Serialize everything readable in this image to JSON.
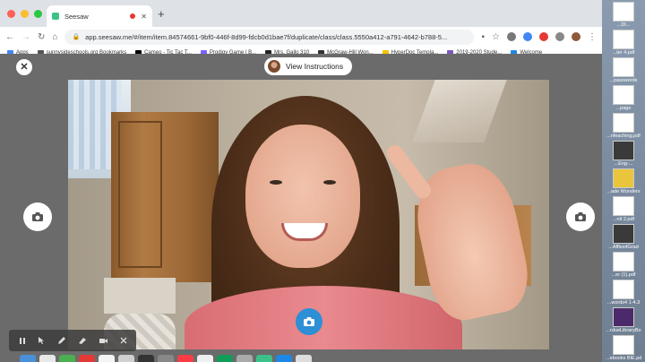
{
  "browser": {
    "tab_title": "Seesaw",
    "new_tab_symbol": "+",
    "url": "app.seesaw.me/#/item/item.84574661-9bf0-446f-8d99-fdcb0d1bae7f/duplicate/class/class.5550a412-a791-4642-b788-5...",
    "bookmarks": [
      "Apps",
      "sunnysideschools.org Bookmarks",
      "Cameo - Tic Tac T...",
      "Prodigy Game | B...",
      "Mrs. Gallo 310",
      "McGraw-Hill Won...",
      "HyperDoc Templa...",
      "2019-2020 Stude...",
      "Welcome"
    ],
    "bookmark_colors": [
      "#4285f4",
      "#555555",
      "#000000",
      "#7b61ff",
      "#222222",
      "#333333",
      "#f5c400",
      "#7e57c2",
      "#1e88e5"
    ]
  },
  "seesaw": {
    "close_symbol": "✕",
    "instructions_label": "View Instructions",
    "accent_color": "#2d8fd5"
  },
  "desktop_files": [
    {
      "label": "...Dl...",
      "style": ""
    },
    {
      "label": "...ter 4.pdf",
      "style": ""
    },
    {
      "label": "...passwords",
      "style": ""
    },
    {
      "label": "...page",
      "style": ""
    },
    {
      "label": "...nfeaching.pdf",
      "style": ""
    },
    {
      "label": "...Eng-...",
      "style": "dark"
    },
    {
      "label": "...ade Wonders",
      "style": "yellow"
    },
    {
      "label": "...nit 2.pdf",
      "style": ""
    },
    {
      "label": "...Affles4Grad",
      "style": "dark"
    },
    {
      "label": "...er (1).pdf",
      "style": ""
    },
    {
      "label": "...words4 1-4.3",
      "style": ""
    },
    {
      "label": "...rdueLibraryBo",
      "style": "purple"
    },
    {
      "label": "...ebooks BIE.pdf",
      "style": ""
    }
  ]
}
